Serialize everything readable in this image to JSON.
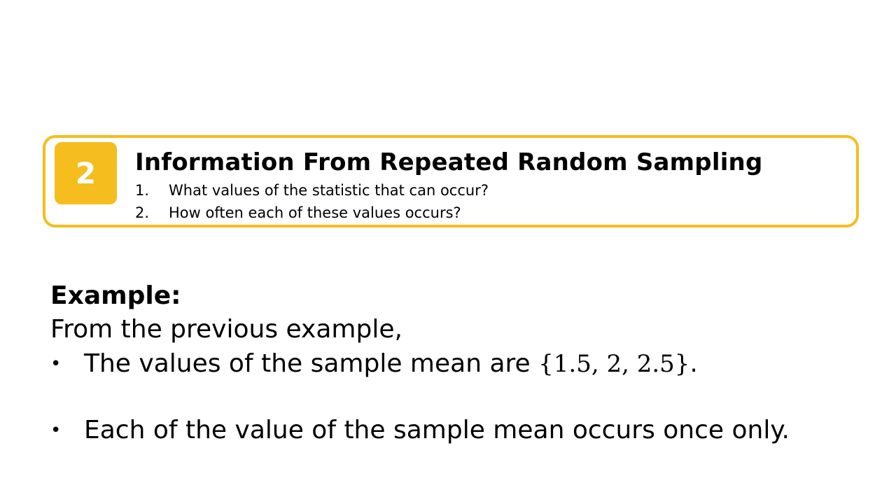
{
  "callout": {
    "badge": "2",
    "title": "Information From Repeated Random Sampling",
    "questions": [
      {
        "num": "1.",
        "text": "What values of the statistic that can occur?"
      },
      {
        "num": "2.",
        "text": "How often each of these values occurs?"
      }
    ]
  },
  "example": {
    "heading": "Example:",
    "intro": "From the previous example,",
    "bullets": [
      {
        "marker": "•",
        "text": "The values of the sample mean are ",
        "math": "{1.5, 2, 2.5}",
        "after": "."
      },
      {
        "marker": "•",
        "text": "Each of the value of the sample mean occurs once only."
      }
    ]
  },
  "colors": {
    "accent": "#F5BE1E",
    "text": "#000000",
    "background": "#ffffff"
  }
}
